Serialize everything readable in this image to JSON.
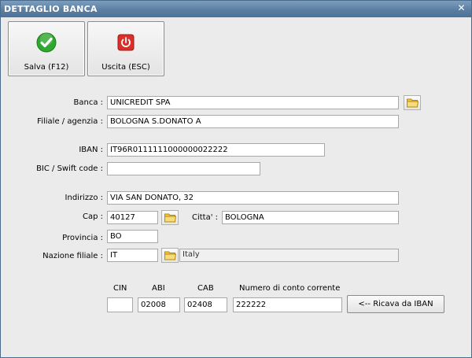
{
  "window": {
    "title": "DETTAGLIO BANCA"
  },
  "toolbar": {
    "save_label": "Salva (F12)",
    "exit_label": "Uscita (ESC)"
  },
  "form": {
    "banca": {
      "label": "Banca :",
      "value": "UNICREDIT SPA"
    },
    "filiale": {
      "label": "Filiale / agenzia :",
      "value": "BOLOGNA S.DONATO A"
    },
    "iban": {
      "label": "IBAN :",
      "value": "IT96R0111111000000022222"
    },
    "bic": {
      "label": "BIC / Swift code :",
      "value": ""
    },
    "indirizzo": {
      "label": "Indirizzo :",
      "value": "VIA SAN DONATO, 32"
    },
    "cap": {
      "label": "Cap :",
      "value": "40127"
    },
    "citta": {
      "label": "Citta' :",
      "value": "BOLOGNA"
    },
    "provincia": {
      "label": "Provincia :",
      "value": "BO"
    },
    "nazione": {
      "label": "Nazione filiale :",
      "code": "IT",
      "name": "Italy"
    }
  },
  "bank_codes": {
    "cin": {
      "label": "CIN",
      "value": ""
    },
    "abi": {
      "label": "ABI",
      "value": "02008"
    },
    "cab": {
      "label": "CAB",
      "value": "02408"
    },
    "conto": {
      "label": "Numero di conto corrente",
      "value": "222222"
    }
  },
  "actions": {
    "ricava_label": "<-- Ricava da IBAN"
  },
  "colors": {
    "titlebar": "#5b7fa3",
    "background": "#ebebeb",
    "save_icon": "#2fa82f",
    "exit_icon": "#d9302a",
    "folder_icon": "#f2c94c"
  }
}
